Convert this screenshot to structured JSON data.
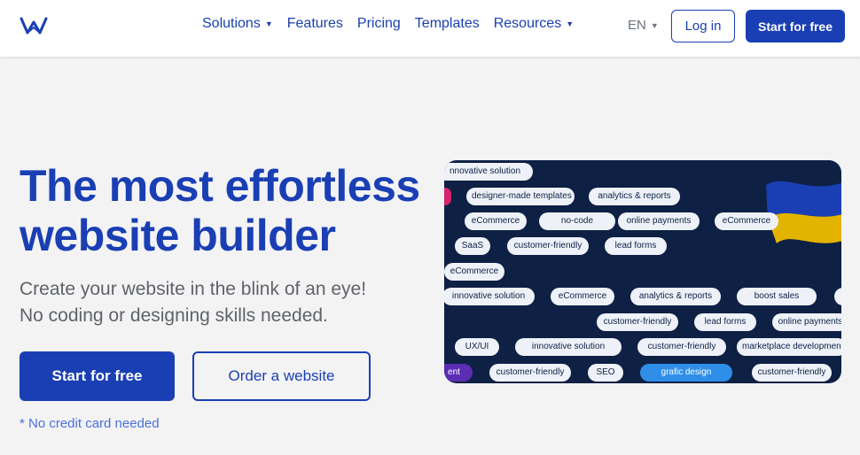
{
  "nav": {
    "items": [
      {
        "label": "Solutions",
        "dropdown": true
      },
      {
        "label": "Features",
        "dropdown": false
      },
      {
        "label": "Pricing",
        "dropdown": false
      },
      {
        "label": "Templates",
        "dropdown": false
      },
      {
        "label": "Resources",
        "dropdown": true
      }
    ],
    "language": "EN",
    "login_label": "Log in",
    "start_label": "Start for free"
  },
  "hero": {
    "title_line1": "The most effortless",
    "title_line2": "website builder",
    "subtitle_line1": "Create your website in the blink of an eye!",
    "subtitle_line2": "No coding or designing skills needed.",
    "primary_cta": "Start for free",
    "secondary_cta": "Order a website",
    "note": "* No credit card needed"
  },
  "card": {
    "tags": [
      "nnovative solution",
      "designer-made templates",
      "analytics & reports",
      "eCommerce",
      "no-code",
      "online payments",
      "eCommerce",
      "SaaS",
      "customer-friendly",
      "lead forms",
      "eCommerce",
      "innovative solution",
      "eCommerce",
      "analytics & reports",
      "boost sales",
      "customer-friendly",
      "lead forms",
      "online payments",
      "UX/UI",
      "innovative solution",
      "customer-friendly",
      "marketplace development",
      "ent",
      "customer-friendly",
      "SEO",
      "grafic design",
      "customer-friendly"
    ]
  },
  "colors": {
    "brand": "#1a3fb4",
    "card_bg": "#0e2044",
    "tag_bg": "#eef2f8",
    "tag_highlight": "#2f8ee8",
    "tag_purple": "#5a2db3",
    "flag_blue": "#1a3fb4",
    "flag_yellow": "#e2b400"
  }
}
